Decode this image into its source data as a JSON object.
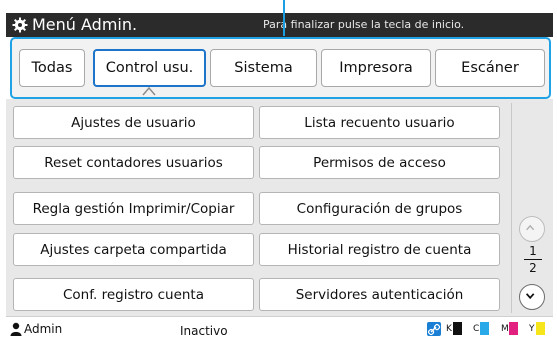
{
  "header": {
    "title": "Menú Admin.",
    "hint": "Para finalizar pulse la tecla de inicio."
  },
  "tabs": [
    {
      "label": "Todas",
      "active": false
    },
    {
      "label": "Control usu.",
      "active": true
    },
    {
      "label": "Sistema",
      "active": false
    },
    {
      "label": "Impresora",
      "active": false
    },
    {
      "label": "Escáner",
      "active": false
    }
  ],
  "menu": {
    "left": [
      "Ajustes de usuario",
      "Reset contadores usuarios",
      "Regla gestión Imprimir/Copiar",
      "Ajustes carpeta compartida",
      "Conf. registro cuenta"
    ],
    "right": [
      "Lista recuento usuario",
      "Permisos de acceso",
      "Configuración de grupos",
      "Historial registro de cuenta",
      "Servidores autenticación"
    ]
  },
  "pagination": {
    "current": "1",
    "total": "2"
  },
  "status": {
    "user": "Admin",
    "state": "Inactivo",
    "inks": [
      {
        "label": "K",
        "color": "#111111"
      },
      {
        "label": "C",
        "color": "#29a9e8"
      },
      {
        "label": "M",
        "color": "#e1207f"
      },
      {
        "label": "Y",
        "color": "#f6e51a"
      }
    ]
  },
  "colors": {
    "accent": "#1fa3e6",
    "active_tab_border": "#1e74c9",
    "header_bg": "#2b2b2b"
  }
}
